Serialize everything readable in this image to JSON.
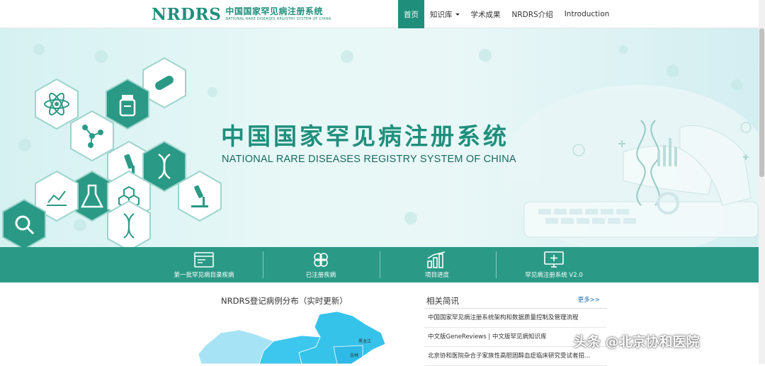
{
  "header": {
    "logo_mark": "NRDRS",
    "logo_cn": "中国国家罕见病注册系统",
    "logo_en": "NATIONAL RARE DISEASES REGISTRY SYSTEM OF CHINA",
    "nav": [
      {
        "label": "首页",
        "active": true
      },
      {
        "label": "知识库",
        "dropdown": true
      },
      {
        "label": "学术成果"
      },
      {
        "label": "NRDRS介绍"
      },
      {
        "label": "Introduction"
      }
    ]
  },
  "banner": {
    "title_cn": "中国国家罕见病注册系统",
    "title_en": "NATIONAL RARE DISEASES REGISTRY SYSTEM OF CHINA"
  },
  "features": [
    {
      "label": "第一批罕见病目录疾病",
      "icon": "browser-window-icon"
    },
    {
      "label": "已注册疾病",
      "icon": "clover-icon"
    },
    {
      "label": "项目进度",
      "icon": "bar-chart-icon"
    },
    {
      "label": "罕见病注册系统 V2.0",
      "icon": "monitor-medical-icon"
    }
  ],
  "map": {
    "title": "NRDRS登记病例分布（实时更新）",
    "labels": [
      "黑龙江",
      "吉林"
    ]
  },
  "news": {
    "title": "相关简讯",
    "more": "更多>>",
    "items": [
      "中国国家罕见病注册系统架构和数据质量控制及管理流程",
      "中文版GeneReviews | 中文版罕见病知识库",
      "北京协和医院杂合子家族性高胆固醇血症临床研究受试者招..."
    ]
  },
  "watermark": "头条 @北京协和医院",
  "colors": {
    "brand": "#1f8f7c",
    "feature_bar": "#2a9a86",
    "link": "#1f6fb3"
  }
}
